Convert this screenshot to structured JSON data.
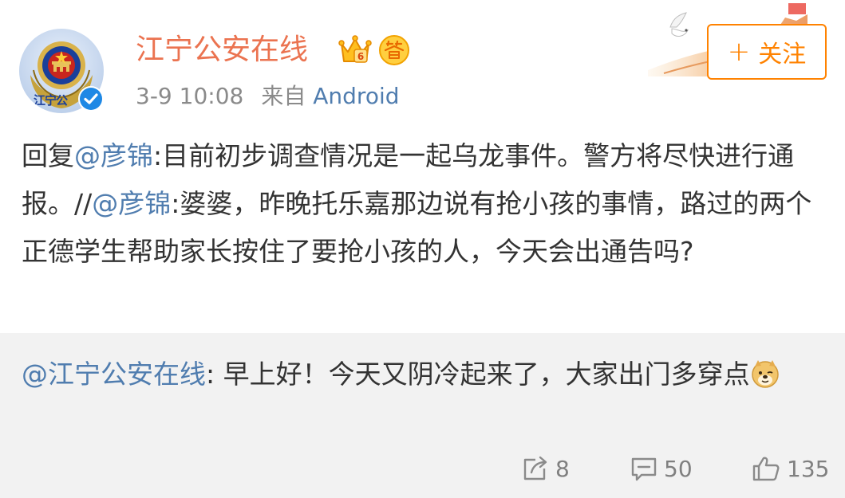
{
  "author": {
    "name": "江宁公安在线",
    "avatar_text": "江宁公",
    "time": "3-9 10:08",
    "source_prefix": "来自",
    "source": "Android"
  },
  "follow_button": {
    "plus": "+",
    "label": "关注"
  },
  "reply": {
    "prefix": "回复",
    "mention": "@彦锦",
    "text_1": ":目前初步调查情况是一起乌龙事件。警方将尽快进行通报。//",
    "mention_2": "@彦锦",
    "text_2": ":婆婆，昨晚托乐嘉那边说有抢小孩的事情，路过的两个正德学生帮助家长按住了要抢小孩的人，今天会出通告吗?"
  },
  "quoted": {
    "mention": "@江宁公安在线",
    "text": ": 早上好！今天又阴冷起来了，大家出门多穿点"
  },
  "actions": {
    "reposts": "8",
    "comments": "50",
    "likes": "135"
  },
  "colors": {
    "username": "#eb7350",
    "link": "#507daf",
    "follow": "#ff8200",
    "meta": "#8a8a8a",
    "quoted_bg": "#f2f2f2"
  },
  "icons": [
    "police-emblem-avatar",
    "verified-icon",
    "crown-badge-icon",
    "answer-badge-icon",
    "repost-icon",
    "comment-icon",
    "like-icon",
    "doge-emoji"
  ]
}
